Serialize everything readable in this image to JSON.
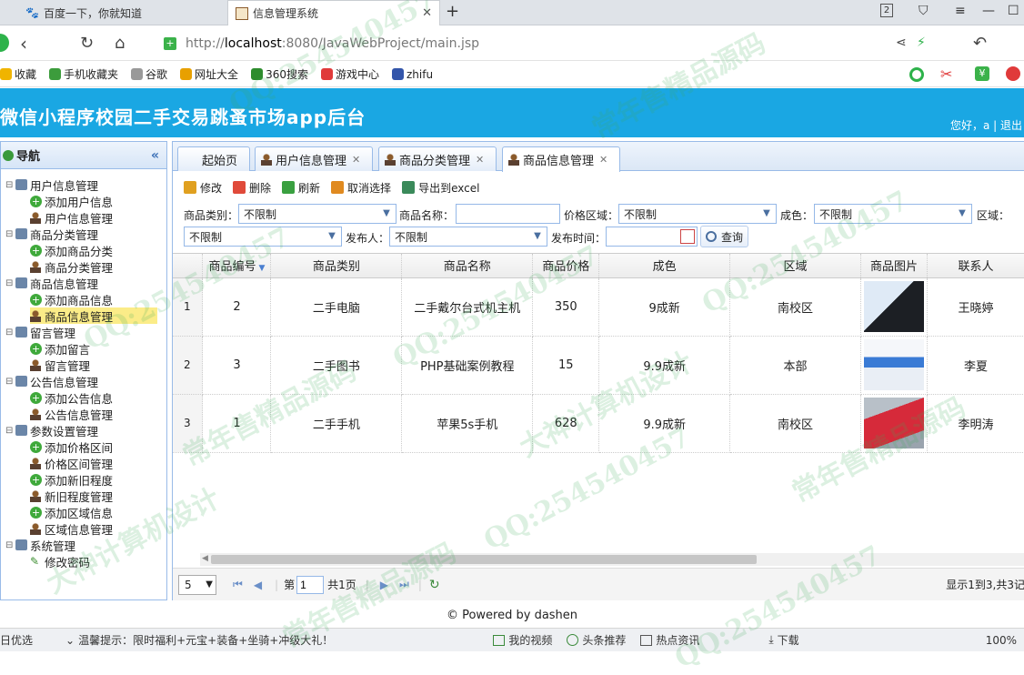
{
  "browser": {
    "tabs": [
      {
        "label": "百度一下，你就知道",
        "icon": "paw-icon"
      },
      {
        "label": "信息管理系统",
        "icon": "page-icon"
      }
    ],
    "tab_counter": "2",
    "url_prefix": "http://",
    "url_host": "localhost",
    "url_rest": ":8080/JavaWebProject/main.jsp"
  },
  "bookmarks": [
    {
      "label": "收藏",
      "color": "#f0b400"
    },
    {
      "label": "手机收藏夹",
      "color": "#3c9c3c"
    },
    {
      "label": "谷歌",
      "color": "#999999"
    },
    {
      "label": "网址大全",
      "color": "#e8a000"
    },
    {
      "label": "360搜索",
      "color": "#2d8c2d"
    },
    {
      "label": "游戏中心",
      "color": "#e03a3a"
    },
    {
      "label": "zhifu",
      "color": "#3355aa"
    }
  ],
  "app": {
    "title": "微信小程序校园二手交易跳蚤市场app后台",
    "greeting": "您好，a | 退出"
  },
  "sidebar": {
    "title": "导航",
    "groups": [
      {
        "label": "用户信息管理",
        "items": [
          {
            "label": "添加用户信息",
            "type": "add"
          },
          {
            "label": "用户信息管理",
            "type": "user"
          }
        ]
      },
      {
        "label": "商品分类管理",
        "items": [
          {
            "label": "添加商品分类",
            "type": "add"
          },
          {
            "label": "商品分类管理",
            "type": "user"
          }
        ]
      },
      {
        "label": "商品信息管理",
        "items": [
          {
            "label": "添加商品信息",
            "type": "add"
          },
          {
            "label": "商品信息管理",
            "type": "user",
            "selected": true
          }
        ]
      },
      {
        "label": "留言管理",
        "items": [
          {
            "label": "添加留言",
            "type": "add"
          },
          {
            "label": "留言管理",
            "type": "user"
          }
        ]
      },
      {
        "label": "公告信息管理",
        "items": [
          {
            "label": "添加公告信息",
            "type": "add"
          },
          {
            "label": "公告信息管理",
            "type": "user"
          }
        ]
      },
      {
        "label": "参数设置管理",
        "items": [
          {
            "label": "添加价格区间",
            "type": "add"
          },
          {
            "label": "价格区间管理",
            "type": "user"
          },
          {
            "label": "添加新旧程度",
            "type": "add"
          },
          {
            "label": "新旧程度管理",
            "type": "user"
          },
          {
            "label": "添加区域信息",
            "type": "add"
          },
          {
            "label": "区域信息管理",
            "type": "user"
          }
        ]
      },
      {
        "label": "系统管理",
        "items": [
          {
            "label": "修改密码",
            "type": "pen"
          }
        ]
      }
    ]
  },
  "tabs": [
    {
      "label": "起始页",
      "closable": false
    },
    {
      "label": "用户信息管理",
      "closable": true
    },
    {
      "label": "商品分类管理",
      "closable": true
    },
    {
      "label": "商品信息管理",
      "closable": true,
      "active": true
    }
  ],
  "toolbar": [
    {
      "label": "修改",
      "icon": "edit-icon",
      "color": "#e0a020"
    },
    {
      "label": "删除",
      "icon": "delete-icon",
      "color": "#e04a3a"
    },
    {
      "label": "刷新",
      "icon": "refresh-icon",
      "color": "#3aa040"
    },
    {
      "label": "取消选择",
      "icon": "undo-icon",
      "color": "#e08a20"
    },
    {
      "label": "导出到excel",
      "icon": "export-icon",
      "color": "#3a8a5a"
    }
  ],
  "filters": {
    "category_label": "商品类别：",
    "category_value": "不限制",
    "name_label": "商品名称：",
    "name_value": "",
    "price_label": "价格区域：",
    "price_value": "不限制",
    "condition_label": "成色：",
    "condition_value": "不限制",
    "area_label": "区域：",
    "area_value": "不限制",
    "publisher_label": "发布人：",
    "publisher_value": "不限制",
    "time_label": "发布时间：",
    "time_value": "",
    "query_label": "查询"
  },
  "grid": {
    "columns": [
      "商品编号",
      "商品类别",
      "商品名称",
      "商品价格",
      "成色",
      "区域",
      "商品图片",
      "联系人"
    ],
    "rows": [
      {
        "rownum": "1",
        "id": "2",
        "category": "二手电脑",
        "name": "二手戴尔台式机主机",
        "price": "350",
        "condition": "9成新",
        "area": "南校区",
        "image": "desktop-pc-image",
        "contact": "王晓婷"
      },
      {
        "rownum": "2",
        "id": "3",
        "category": "二手图书",
        "name": "PHP基础案例教程",
        "price": "15",
        "condition": "9.9成新",
        "area": "本部",
        "image": "php-book-image",
        "contact": "李夏"
      },
      {
        "rownum": "3",
        "id": "1",
        "category": "二手手机",
        "name": "苹果5s手机",
        "price": "628",
        "condition": "9.9成新",
        "area": "南校区",
        "image": "red-phone-image",
        "contact": "李明涛"
      }
    ]
  },
  "pager": {
    "page_size": "5",
    "page_prefix": "第",
    "page_value": "1",
    "page_suffix": "共1页",
    "summary": "显示1到3,共3记"
  },
  "footer": "© Powered by dashen",
  "statusbar": {
    "left": "日优选",
    "tip": "温馨提示：限时福利+元宝+装备+坐骑+冲级大礼！",
    "items": [
      "我的视频",
      "头条推荐",
      "热点资讯",
      "下载"
    ],
    "zoom": "100%"
  },
  "watermarks": [
    "QQ:254540457",
    "常年售精品源码",
    "大神计算机设计"
  ]
}
